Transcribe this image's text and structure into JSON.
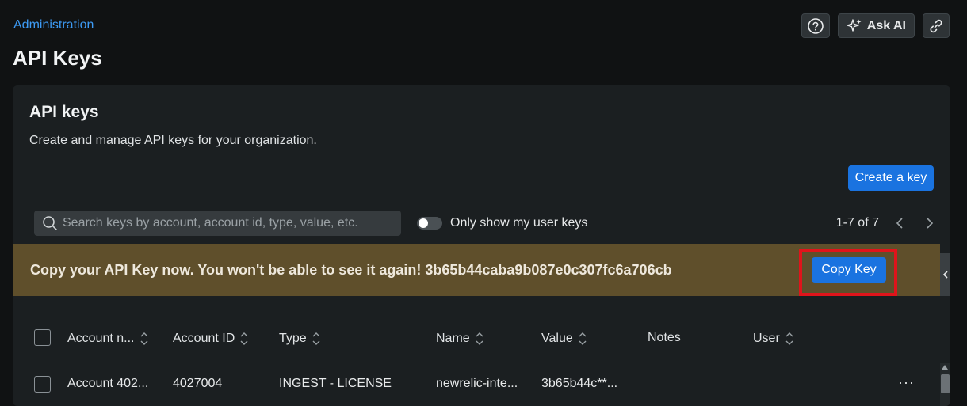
{
  "header": {
    "breadcrumb": "Administration",
    "title": "API Keys",
    "ask_ai_label": "Ask AI"
  },
  "card": {
    "title": "API keys",
    "description": "Create and manage API keys for your organization.",
    "create_button": "Create a key"
  },
  "search": {
    "placeholder": "Search keys by account, account id, type, value, etc.",
    "value": ""
  },
  "filter": {
    "toggle_label": "Only show my user keys",
    "toggle_on": false
  },
  "pagination": {
    "text": "1-7 of 7"
  },
  "banner": {
    "message": "Copy your API Key now. You won't be able to see it again! 3b65b44caba9b087e0c307fc6a706cb",
    "copy_button": "Copy Key"
  },
  "table": {
    "columns": [
      {
        "label": "Account n...",
        "sortable": true
      },
      {
        "label": "Account ID",
        "sortable": true
      },
      {
        "label": "Type",
        "sortable": true
      },
      {
        "label": "Name",
        "sortable": true
      },
      {
        "label": "Value",
        "sortable": true
      },
      {
        "label": "Notes",
        "sortable": false
      },
      {
        "label": "User",
        "sortable": true
      }
    ],
    "rows": [
      {
        "account_name": "Account 402...",
        "account_id": "4027004",
        "type": "INGEST - LICENSE",
        "name": "newrelic-inte...",
        "value": "3b65b44c**...",
        "notes": "",
        "user": "",
        "actions": "···"
      }
    ]
  },
  "colors": {
    "background": "#101213",
    "card": "#1b1f21",
    "accent": "#1a73e0",
    "banner": "#5f4f2b",
    "highlight": "#e0141b",
    "link": "#3d9bf5"
  },
  "icons": [
    "help-icon",
    "sparkle-icon",
    "link-icon",
    "search-icon",
    "chevron-left-icon",
    "chevron-right-icon",
    "sort-icon",
    "more-icon"
  ]
}
